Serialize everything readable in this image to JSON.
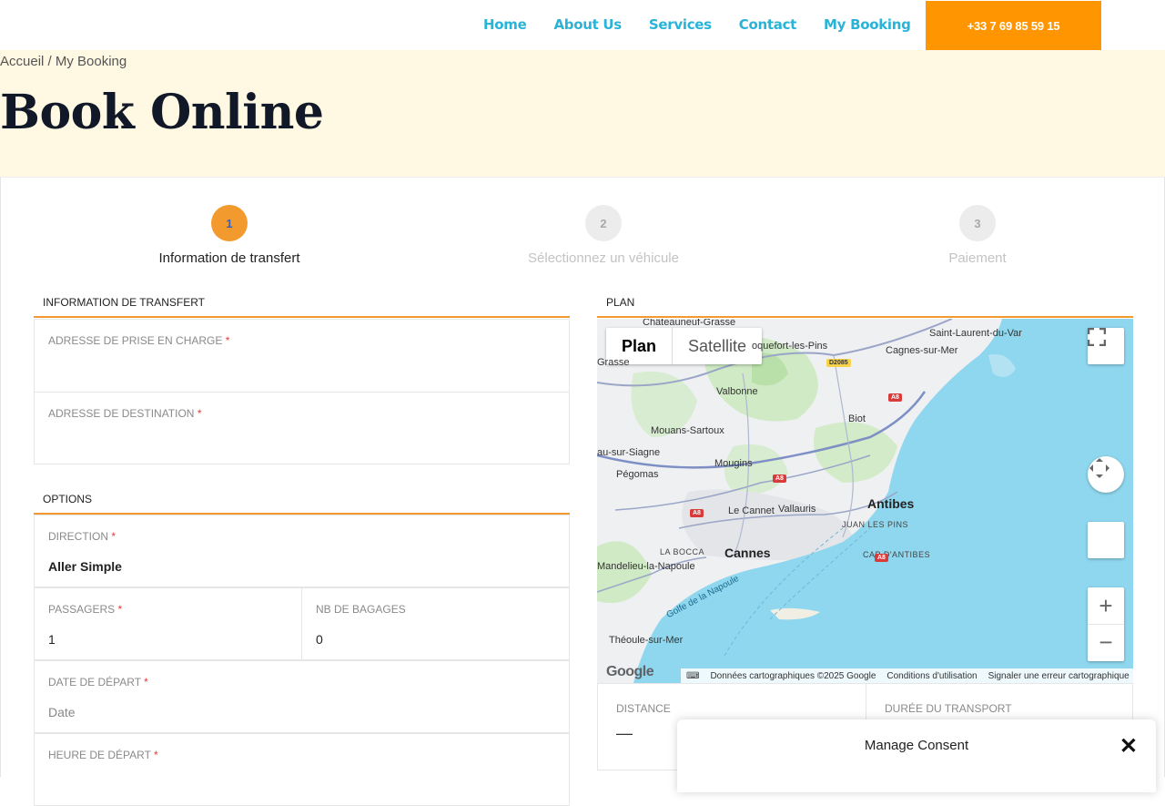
{
  "nav": {
    "items": [
      "Home",
      "About Us",
      "Services",
      "Contact",
      "My Booking"
    ],
    "phone": "+33 7 69 85 59 15"
  },
  "breadcrumb": {
    "home": "Accueil",
    "separator": "/",
    "current": "My Booking"
  },
  "page": {
    "title": "Book Online"
  },
  "steps": [
    {
      "number": "1",
      "label": "Information de transfert",
      "state": "active"
    },
    {
      "number": "2",
      "label": "Sélectionnez un véhicule",
      "state": "inactive"
    },
    {
      "number": "3",
      "label": "Paiement",
      "state": "inactive"
    }
  ],
  "transfer_section": {
    "title": "INFORMATION DE TRANSFERT",
    "pickup_label": "ADRESSE DE PRISE EN CHARGE",
    "destination_label": "ADRESSE DE DESTINATION",
    "required_mark": "*"
  },
  "options_section": {
    "title": "OPTIONS",
    "direction_label": "DIRECTION",
    "direction_value": "Aller Simple",
    "passengers_label": "PASSAGERS",
    "passengers_value": "1",
    "bags_label": "NB DE BAGAGES",
    "bags_value": "0",
    "date_label": "DATE DE DÉPART",
    "date_placeholder": "Date",
    "time_label": "HEURE DE DÉPART"
  },
  "map_section": {
    "title": "PLAN",
    "toggle_plan": "Plan",
    "toggle_satellite": "Satellite",
    "places": {
      "chateauneuf": "Châteauneuf-Grasse",
      "roquefort": "oquefort-les-Pins",
      "grasse": "Grasse",
      "saint_laurent": "Saint-Laurent-du-Var",
      "cagnes": "Cagnes-sur-Mer",
      "valbonne": "Valbonne",
      "biot": "Biot",
      "mouans": "Mouans-Sartoux",
      "siagne": "au-sur-Siagne",
      "mougins": "Mougins",
      "pegomas": "Pégomas",
      "antibes": "Antibes",
      "le_cannet": "Le Cannet",
      "vallauris": "Vallauris",
      "juan": "JUAN LES PINS",
      "la_bocca": "LA BOCCA",
      "cannes": "Cannes",
      "cap": "CAP D'ANTIBES",
      "mandelieu": "Mandelieu-la-Napoule",
      "golfe": "Golfe de la Napoule",
      "theoule": "Théoule-sur-Mer"
    },
    "roads": {
      "a8": "A8",
      "d2085": "D2085"
    },
    "google": "Google",
    "footer_data": "Données cartographiques ©2025 Google",
    "footer_terms": "Conditions d'utilisation",
    "footer_report": "Signaler une erreur cartographique",
    "zoom_in": "+",
    "zoom_out": "−"
  },
  "stats": {
    "distance_label": "DISTANCE",
    "distance_value": "—",
    "duration_label": "DURÉE DU TRANSPORT"
  },
  "consent": {
    "title": "Manage Consent",
    "close": "✕"
  },
  "colors": {
    "accent": "#f29a2e",
    "nav": "#2ab3d8",
    "phone_button": "#ff9500",
    "banner": "#fff9e3",
    "sea": "#8fd7ee"
  }
}
